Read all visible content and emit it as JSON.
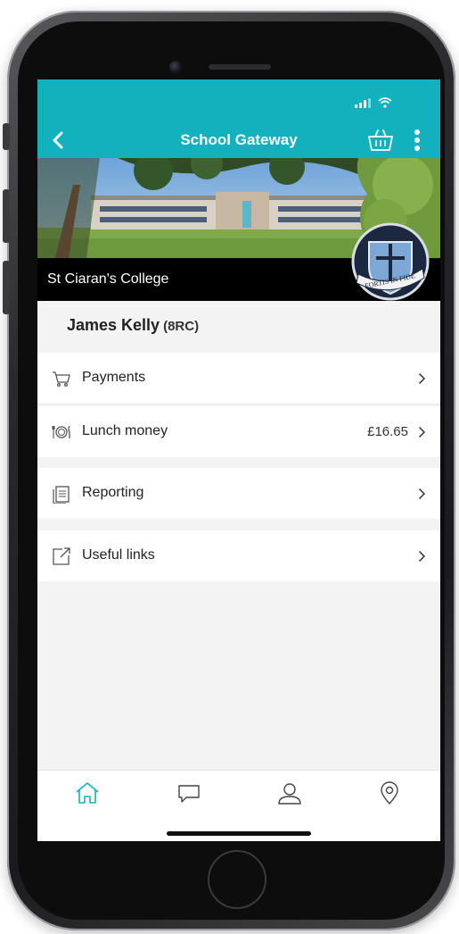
{
  "header": {
    "title": "School Gateway"
  },
  "school": {
    "name": "St Ciaran's College",
    "crest_motto": "FORTIS IN FIDE"
  },
  "student": {
    "name": "James Kelly",
    "class": "(8RC)"
  },
  "menu": {
    "payments": {
      "label": "Payments",
      "icon": "shopping-cart-icon"
    },
    "lunch_money": {
      "label": "Lunch money",
      "value": "£16.65",
      "icon": "plate-cutlery-icon"
    },
    "reporting": {
      "label": "Reporting",
      "icon": "document-icon"
    },
    "useful_links": {
      "label": "Useful links",
      "icon": "external-link-icon"
    }
  },
  "tabs": [
    {
      "name": "home",
      "icon": "home-icon",
      "active": true
    },
    {
      "name": "messages",
      "icon": "chat-bubble-icon",
      "active": false
    },
    {
      "name": "profile",
      "icon": "user-icon",
      "active": false
    },
    {
      "name": "location",
      "icon": "map-pin-icon",
      "active": false
    }
  ],
  "colors": {
    "accent": "#12b1bd",
    "background": "#f3f3f3",
    "active_tab": "#12b1bd",
    "inactive_tab": "#444444"
  }
}
